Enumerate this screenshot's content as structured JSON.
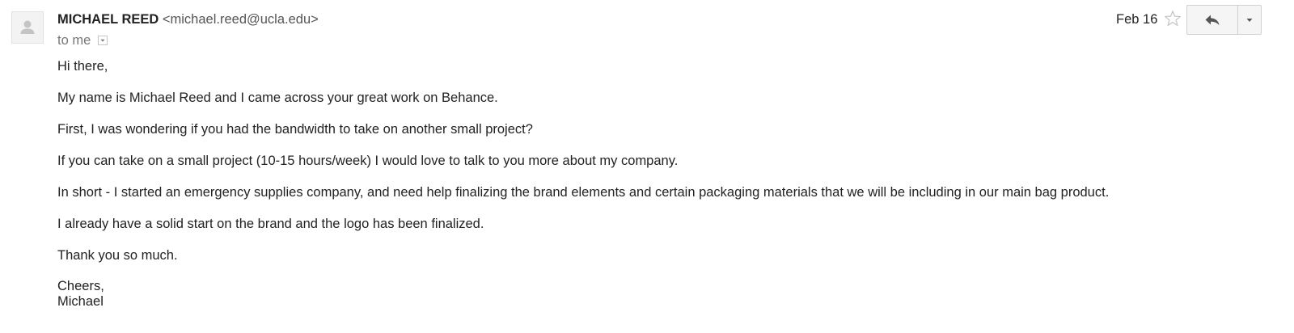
{
  "sender": {
    "name": "MICHAEL REED",
    "email": "<michael.reed@ucla.edu>"
  },
  "recipient": {
    "to": "to me"
  },
  "date": "Feb 16",
  "icons": {
    "avatar": "person-icon",
    "star": "star-outline-icon",
    "reply": "reply-arrow-icon",
    "more": "caret-down-icon",
    "details": "details-dropdown-icon"
  },
  "body": {
    "paragraphs": [
      "Hi there,",
      "My name is Michael Reed and I came across your great work on Behance.",
      "First, I was wondering if you had the bandwidth to take on another small project?",
      "If you can take on a small project (10-15 hours/week) I would love to talk to you more about my company.",
      "In short - I started an emergency supplies company, and need help finalizing the brand elements and certain packaging materials that we will be including in our main bag product.",
      "I already have a solid start on the brand and the logo has been finalized.",
      "Thank you so much."
    ],
    "closing": "Cheers,",
    "signature": "Michael"
  },
  "colors": {
    "text": "#222222",
    "muted": "#777777",
    "email": "#555555",
    "button_bg": "#f5f5f5",
    "border": "#d0d0d0"
  }
}
